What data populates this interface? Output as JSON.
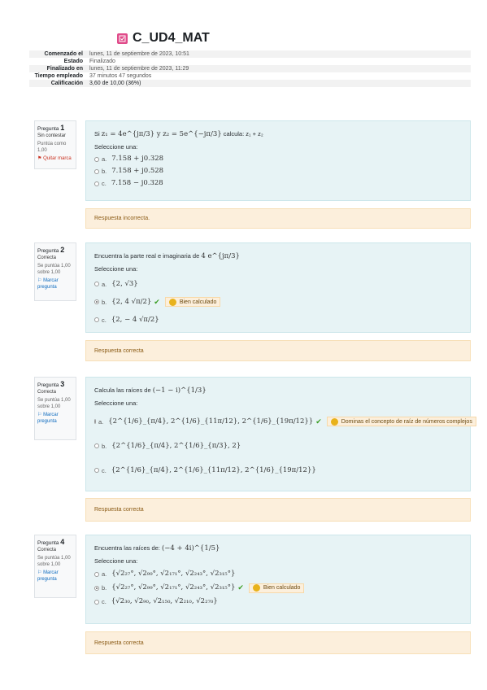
{
  "quiz_title": "C_UD4_MAT",
  "summary": [
    {
      "label": "Comenzado el",
      "value": "lunes, 11 de septiembre de 2023, 10:51"
    },
    {
      "label": "Estado",
      "value": "Finalizado"
    },
    {
      "label": "Finalizado en",
      "value": "lunes, 11 de septiembre de 2023, 11:29"
    },
    {
      "label": "Tiempo empleado",
      "value": "37 minutos 47 segundos"
    },
    {
      "label": "Calificación",
      "value": "3,60 de 10,00 (36%)"
    }
  ],
  "questions": [
    {
      "info": {
        "label": "Pregunta",
        "number": "1",
        "state": "Sin contestar",
        "grade": "Puntúa como 1,00",
        "flag": "Quitar marca"
      },
      "prompt_pre": "Si ",
      "prompt_math": "z₁ = 4e^{jπ/3} y z₂ = 5e^{−jπ/3}",
      "prompt_post": " calcula: z₁ + z₂",
      "select_label": "Seleccione una:",
      "options": [
        {
          "letter": "a.",
          "text": "7.158 + j0.328"
        },
        {
          "letter": "b.",
          "text": "7.158 + j0.528"
        },
        {
          "letter": "c.",
          "text": "7.158 − j0.328"
        }
      ],
      "outcome": "Respuesta incorrecta."
    },
    {
      "info": {
        "label": "Pregunta",
        "number": "2",
        "state": "Correcta",
        "grade": "Se puntúa 1,00 sobre 1,00",
        "flag": "Marcar pregunta"
      },
      "prompt_pre": "Encuentra la parte real e imaginaria de ",
      "prompt_math": "4 e^{jπ/3}",
      "prompt_post": "",
      "select_label": "Seleccione una:",
      "options": [
        {
          "letter": "a.",
          "text": "{2, √3}"
        },
        {
          "letter": "b.",
          "text": "{2, 4 √π/2}",
          "selected": true,
          "feedback": "Bien calculado"
        },
        {
          "letter": "c.",
          "text": "{2, − 4 √π/2}"
        }
      ],
      "outcome": "Respuesta correcta"
    },
    {
      "info": {
        "label": "Pregunta",
        "number": "3",
        "state": "Correcta",
        "grade": "Se puntúa 1,00 sobre 1,00",
        "flag": "Marcar pregunta"
      },
      "prompt_pre": "Calcula las raíces de ",
      "prompt_math": "(−1 − i)^{1/3}",
      "prompt_post": "",
      "select_label": "Seleccione una:",
      "options": [
        {
          "letter": "a.",
          "text": "{2^{1/6}_{π/4}, 2^{1/6}_{11π/12}, 2^{1/6}_{19π/12}}",
          "selected": true,
          "feedback": "Dominas el concepto de raíz de números complejos"
        },
        {
          "letter": "b.",
          "text": "{2^{1/6}_{π/4}, 2^{1/6}_{π/3}, 2}"
        },
        {
          "letter": "c.",
          "text": "{2^{1/6}_{π/4}, 2^{1/6}_{11π/12}, 2^{1/6}_{19π/12}}"
        }
      ],
      "outcome": "Respuesta correcta"
    },
    {
      "info": {
        "label": "Pregunta",
        "number": "4",
        "state": "Correcta",
        "grade": "Se puntúa 1,00 sobre 1,00",
        "flag": "Marcar pregunta"
      },
      "prompt_pre": "Encuentra las raíces de: ",
      "prompt_math": "(−4 + 4i)^{1/5}",
      "prompt_post": "",
      "select_label": "Seleccione una:",
      "options": [
        {
          "letter": "a.",
          "text": "{√2₂₇°, √2₉₉°, √2₁₇₁°, √2₂₄₃°, √2₃₁₅°}"
        },
        {
          "letter": "b.",
          "text": "{√2₂₇°, √2₉₉°, √2₁₇₁°, √2₂₄₃°, √2₃₁₅°}",
          "selected": true,
          "feedback": "Bien calculado"
        },
        {
          "letter": "c.",
          "text": "{√2₃₀, √2₉₀, √2₁₅₀, √2₂₁₀, √2₂₇₀}"
        }
      ],
      "outcome": "Respuesta correcta"
    }
  ],
  "colors": {
    "accent_pink": "#e04b8a",
    "info_bg": "#e7f3f5",
    "outcome_bg": "#fcefdc",
    "check_green": "#3a9d23"
  },
  "icons": {
    "quiz": "quiz-icon",
    "flag": "flag-icon",
    "check": "check-icon",
    "smile": "smile-icon"
  }
}
